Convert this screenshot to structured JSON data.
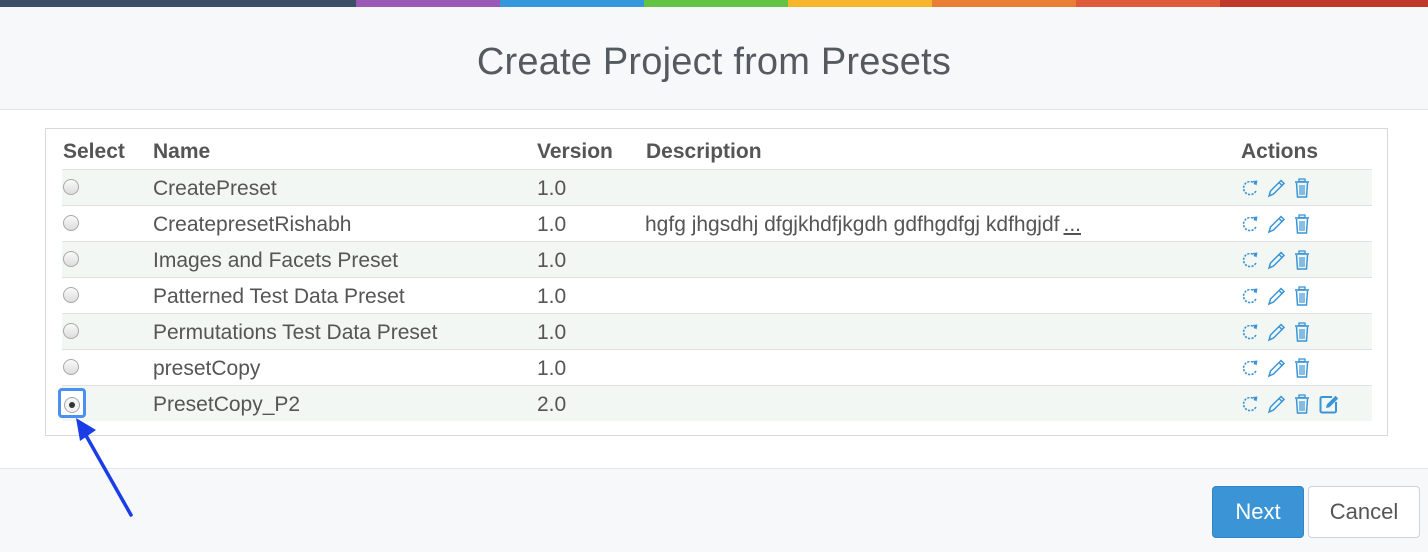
{
  "colorbar": [
    "#3d4f64",
    "#9b59b6",
    "#3498db",
    "#62c344",
    "#f5b62a",
    "#e87f34",
    "#e05a3c",
    "#c0392b"
  ],
  "dialog": {
    "title": "Create Project from Presets"
  },
  "table": {
    "headers": {
      "select": "Select",
      "name": "Name",
      "version": "Version",
      "description": "Description",
      "actions": "Actions"
    },
    "rows": [
      {
        "name": "CreatePreset",
        "version": "1.0",
        "description": "",
        "more": "",
        "selected": false
      },
      {
        "name": "CreatepresetRishabh",
        "version": "1.0",
        "description": "hgfg jhgsdhj dfgjkhdfjkgdh gdfhgdfgj kdfhgjdf",
        "more": "...",
        "selected": false
      },
      {
        "name": "Images and Facets Preset",
        "version": "1.0",
        "description": "",
        "more": "",
        "selected": false
      },
      {
        "name": "Patterned Test Data Preset",
        "version": "1.0",
        "description": "",
        "more": "",
        "selected": false
      },
      {
        "name": "Permutations Test Data Preset",
        "version": "1.0",
        "description": "",
        "more": "",
        "selected": false
      },
      {
        "name": "presetCopy",
        "version": "1.0",
        "description": "",
        "more": "",
        "selected": false
      },
      {
        "name": "PresetCopy_P2",
        "version": "2.0",
        "description": "",
        "more": "",
        "selected": true
      }
    ],
    "row_actions": [
      "refresh-icon",
      "pencil-icon",
      "trash-icon"
    ],
    "selected_row_extra_action": "edit-square-icon",
    "action_color": "#3a94d6"
  },
  "footer": {
    "next_label": "Next",
    "cancel_label": "Cancel"
  },
  "annotation": {
    "arrow_color": "#1a3de8"
  }
}
